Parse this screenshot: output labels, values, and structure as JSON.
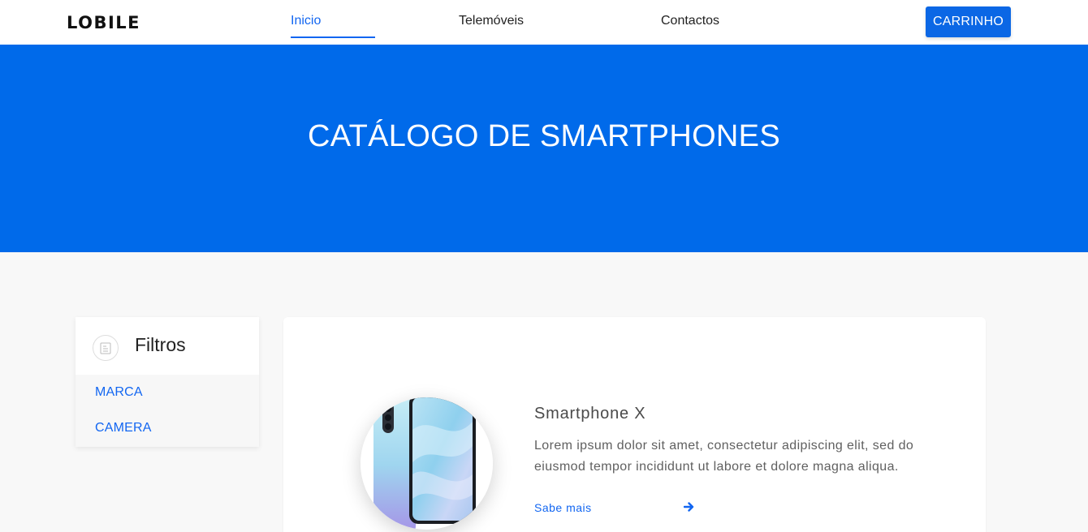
{
  "header": {
    "logo": "LOBILE",
    "nav": [
      {
        "label": "Inicio",
        "active": true
      },
      {
        "label": "Telemóveis",
        "active": false
      },
      {
        "label": "Contactos",
        "active": false
      }
    ],
    "cart_label": "CARRINHO"
  },
  "hero": {
    "title": "CATÁLOGO DE SMARTPHONES"
  },
  "filters": {
    "title": "Filtros",
    "icon": "filter-list-icon",
    "items": [
      {
        "label": "MARCA"
      },
      {
        "label": "CAMERA"
      }
    ]
  },
  "product": {
    "name": "Smartphone X",
    "description": "Lorem ipsum dolor sit amet, consectetur adipiscing elit, sed do eiusmod tempor incididunt ut labore et dolore magna aliqua.",
    "link_label": "Sabe mais",
    "link_icon": "arrow-right-icon",
    "image_icon": "smartphone-image"
  },
  "colors": {
    "accent": "#1266f1",
    "hero_bg": "#006aea",
    "cart_bg": "#0b67e5"
  }
}
